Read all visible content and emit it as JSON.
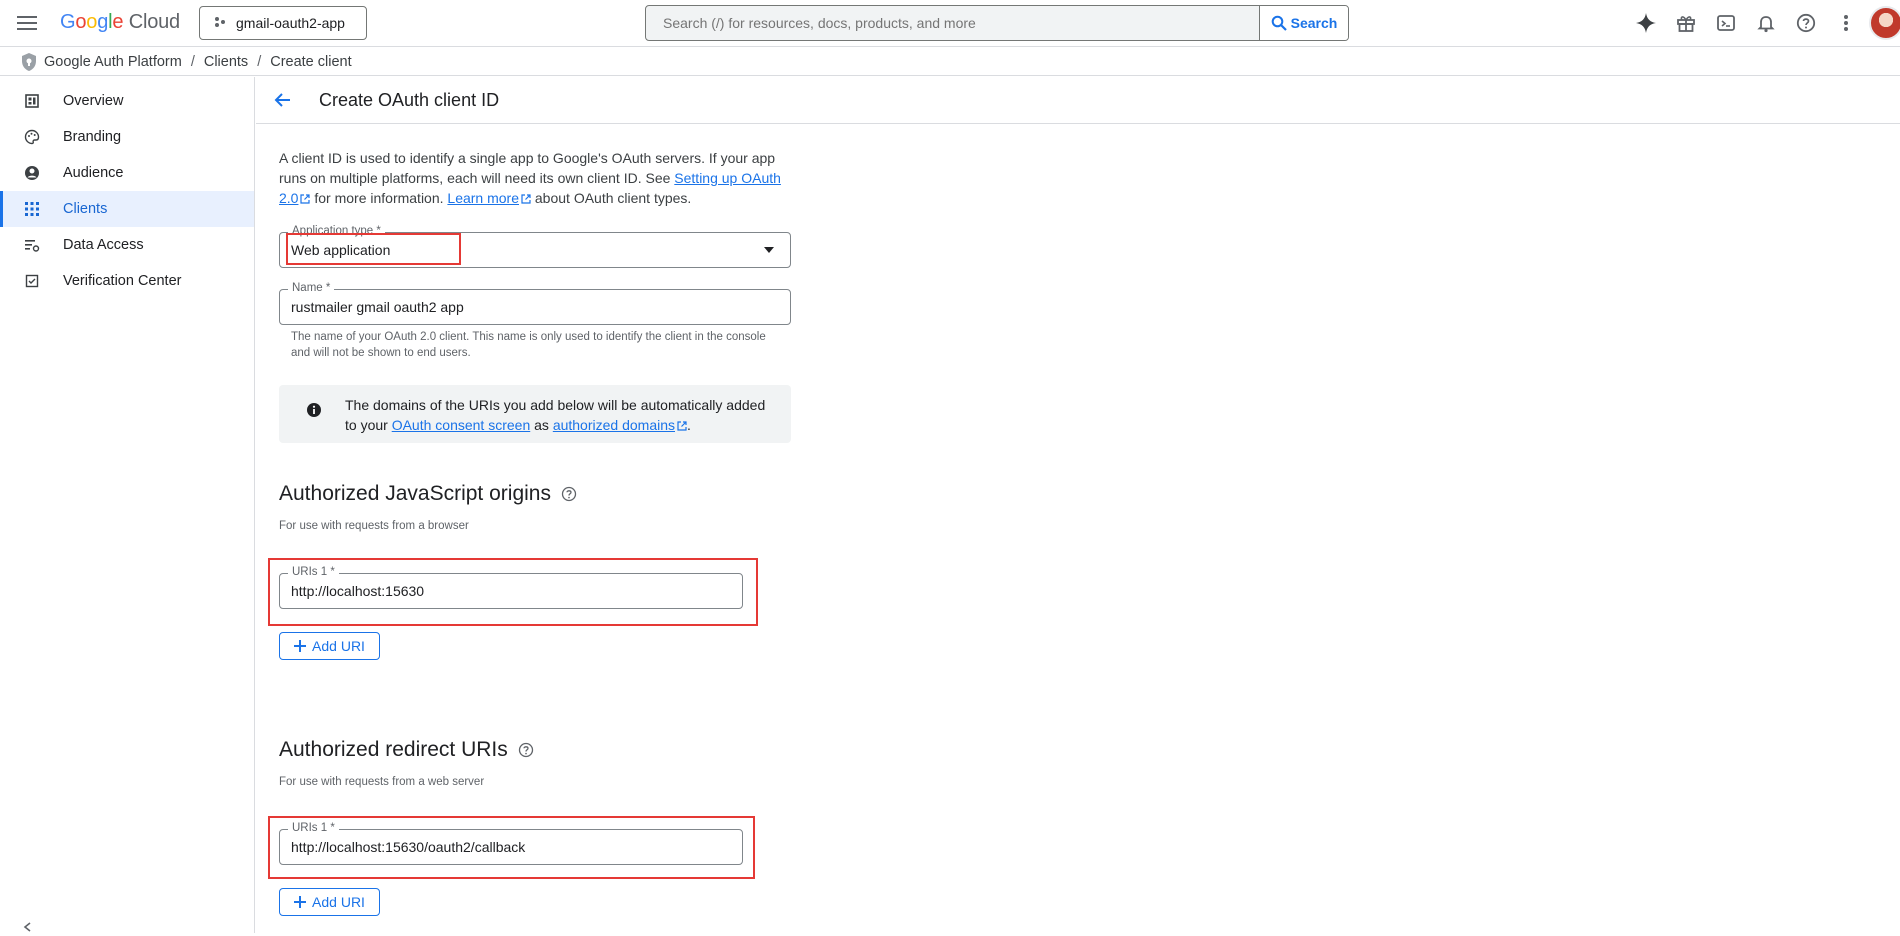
{
  "header": {
    "logo": {
      "google": "Google",
      "cloud": "Cloud"
    },
    "project": "gmail-oauth2-app",
    "search": {
      "placeholder": "Search (/) for resources, docs, products, and more",
      "button": "Search"
    }
  },
  "breadcrumb": [
    "Google Auth Platform",
    "Clients",
    "Create client"
  ],
  "sidebar": {
    "items": [
      {
        "label": "Overview",
        "icon": "dashboard-icon"
      },
      {
        "label": "Branding",
        "icon": "palette-icon"
      },
      {
        "label": "Audience",
        "icon": "account-circle-icon"
      },
      {
        "label": "Clients",
        "icon": "apps-grid-icon",
        "active": true
      },
      {
        "label": "Data Access",
        "icon": "list-settings-icon"
      },
      {
        "label": "Verification Center",
        "icon": "checkbox-icon"
      }
    ]
  },
  "page": {
    "title": "Create OAuth client ID",
    "intro": {
      "part1": "A client ID is used to identify a single app to Google's OAuth servers. If your app runs on multiple platforms, each will need its own client ID. See ",
      "link1": "Setting up OAuth 2.0",
      "part2": " for more information. ",
      "link2": "Learn more",
      "part3": " about OAuth client types."
    },
    "app_type": {
      "label": "Application type *",
      "value": "Web application"
    },
    "name": {
      "label": "Name *",
      "value": "rustmailer gmail oauth2 app",
      "hint": "The name of your OAuth 2.0 client. This name is only used to identify the client in the console and will not be shown to end users."
    },
    "info": {
      "part1": "The domains of the URIs you add below will be automatically added to your ",
      "link1": "OAuth consent screen",
      "part2": " as ",
      "link2": "authorized domains",
      "part3": "."
    },
    "js_origins": {
      "title": "Authorized JavaScript origins",
      "subtitle": "For use with requests from a browser",
      "uri_label": "URIs 1 *",
      "uri_value": "http://localhost:15630",
      "add": "Add URI"
    },
    "redirect": {
      "title": "Authorized redirect URIs",
      "subtitle": "For use with requests from a web server",
      "uri_label": "URIs 1 *",
      "uri_value": "http://localhost:15630/oauth2/callback",
      "add": "Add URI"
    }
  },
  "colors": {
    "accent": "#1a73e8",
    "highlight": "#e53935"
  }
}
